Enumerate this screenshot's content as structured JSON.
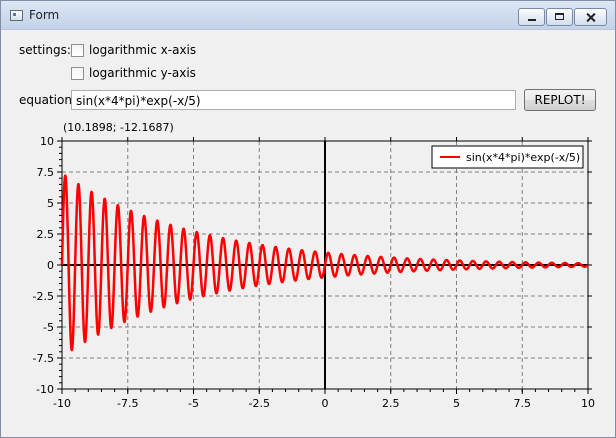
{
  "window": {
    "title": "Form"
  },
  "settings": {
    "label": "settings:",
    "log_x_label": "logarithmic x-axis",
    "log_x_checked": false,
    "log_y_label": "logarithmic y-axis",
    "log_y_checked": false
  },
  "equation": {
    "label": "equation:",
    "value": "sin(x*4*pi)*exp(-x/5)",
    "replot_label": "REPLOT!"
  },
  "readout": {
    "text": "(10.1898; -12.1687)"
  },
  "colors": {
    "curve": "#ff0000",
    "grid": "#808080",
    "axis": "#000000"
  },
  "chart_data": {
    "type": "line",
    "title": "",
    "xlabel": "",
    "ylabel": "",
    "xlim": [
      -10,
      10
    ],
    "ylim": [
      -10,
      10
    ],
    "x_ticks": [
      -10,
      -7.5,
      -5,
      -2.5,
      0,
      2.5,
      5,
      7.5,
      10
    ],
    "x_tick_labels": [
      "-10",
      "-7.5",
      "-5",
      "-2.5",
      "0",
      "2.5",
      "5",
      "7.5",
      "10"
    ],
    "y_ticks": [
      10,
      7.5,
      5,
      2.5,
      0,
      -2.5,
      -5,
      -7.5,
      -10
    ],
    "y_tick_labels": [
      "10",
      "7.5",
      "5",
      "2.5",
      "0",
      "-2.5",
      "-5",
      "-7.5",
      "-10"
    ],
    "grid": true,
    "legend_position": "top-right",
    "series": [
      {
        "name": "sin(x*4*pi)*exp(-x/5)",
        "function": "sin(x*4*pi)*exp(-x/5)",
        "x_range": [
          -10,
          10
        ],
        "color": "#ff0000"
      }
    ]
  }
}
